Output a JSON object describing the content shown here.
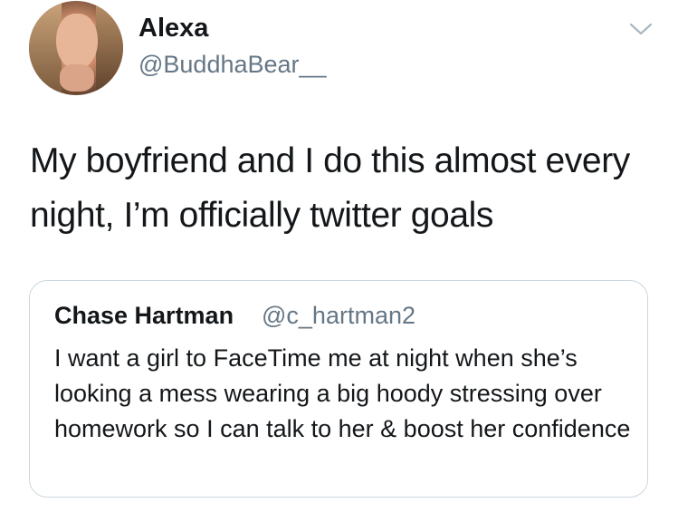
{
  "tweet": {
    "author_name": "Alexa",
    "author_handle": "@BuddhaBear__",
    "text": "My boyfriend and I do this almost every night, I’m officially twitter goals"
  },
  "quoted_tweet": {
    "author_name": "Chase Hartman",
    "author_handle": "@c_hartman2",
    "text": "I want a girl to FaceTime me at night when she’s looking a mess wearing a big hoody stressing over homework so I can talk to her & boost her confidence"
  },
  "icons": {
    "menu": "chevron-down-icon"
  },
  "colors": {
    "text": "#14171a",
    "secondary_text": "#657786",
    "border": "#ccd6dd"
  }
}
